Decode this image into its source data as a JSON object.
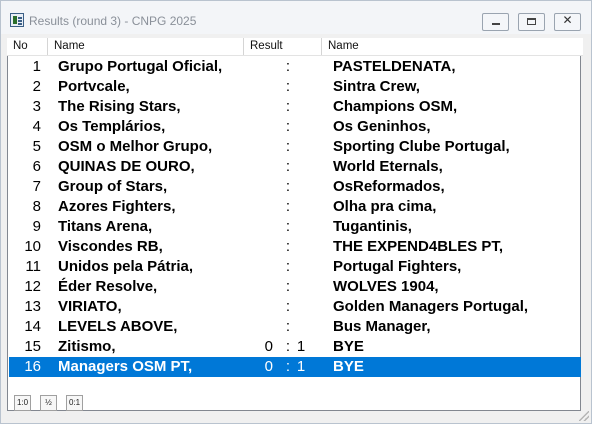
{
  "window": {
    "title": "Results  (round 3) - CNPG 2025"
  },
  "columns": {
    "no": "No",
    "home": "Name",
    "result": "Result",
    "away": "Name"
  },
  "rows": [
    {
      "no": "1",
      "home": "Grupo Portugal Oficial,",
      "home_score": "",
      "sep": ":",
      "away_score": "",
      "away": "PASTELDENATA,"
    },
    {
      "no": "2",
      "home": "Portvcale,",
      "home_score": "",
      "sep": ":",
      "away_score": "",
      "away": "Sintra Crew,"
    },
    {
      "no": "3",
      "home": "The Rising Stars,",
      "home_score": "",
      "sep": ":",
      "away_score": "",
      "away": "Champions OSM,"
    },
    {
      "no": "4",
      "home": "Os Templários,",
      "home_score": "",
      "sep": ":",
      "away_score": "",
      "away": "Os Geninhos,"
    },
    {
      "no": "5",
      "home": "OSM o Melhor Grupo,",
      "home_score": "",
      "sep": ":",
      "away_score": "",
      "away": "Sporting Clube Portugal,"
    },
    {
      "no": "6",
      "home": "QUINAS DE OURO,",
      "home_score": "",
      "sep": ":",
      "away_score": "",
      "away": "World Eternals,"
    },
    {
      "no": "7",
      "home": "Group of Stars,",
      "home_score": "",
      "sep": ":",
      "away_score": "",
      "away": "OsReformados,"
    },
    {
      "no": "8",
      "home": "Azores Fighters,",
      "home_score": "",
      "sep": ":",
      "away_score": "",
      "away": "Olha pra cima,"
    },
    {
      "no": "9",
      "home": "Titans Arena,",
      "home_score": "",
      "sep": ":",
      "away_score": "",
      "away": "Tugantinis,"
    },
    {
      "no": "10",
      "home": "Viscondes RB,",
      "home_score": "",
      "sep": ":",
      "away_score": "",
      "away": "THE EXPEND4BLES PT,"
    },
    {
      "no": "11",
      "home": "Unidos pela Pátria,",
      "home_score": "",
      "sep": ":",
      "away_score": "",
      "away": "Portugal Fighters,"
    },
    {
      "no": "12",
      "home": "Éder Resolve,",
      "home_score": "",
      "sep": ":",
      "away_score": "",
      "away": "WOLVES 1904,"
    },
    {
      "no": "13",
      "home": "VIRIATO,",
      "home_score": "",
      "sep": ":",
      "away_score": "",
      "away": "Golden Managers Portugal,"
    },
    {
      "no": "14",
      "home": "LEVELS ABOVE,",
      "home_score": "",
      "sep": ":",
      "away_score": "",
      "away": "Bus Manager,"
    },
    {
      "no": "15",
      "home": "Zitismo,",
      "home_score": "0",
      "sep": ":",
      "away_score": "1",
      "away": "BYE"
    },
    {
      "no": "16",
      "home": "Managers OSM PT,",
      "home_score": "0",
      "sep": ":",
      "away_score": "1",
      "away": "BYE"
    }
  ],
  "selected_row": "16",
  "toolbar": {
    "btn_home_win": "1:0",
    "btn_draw": "½",
    "btn_away_win": "0:1"
  },
  "colors": {
    "selection": "#0078d7",
    "selection_text": "#ffffff"
  }
}
